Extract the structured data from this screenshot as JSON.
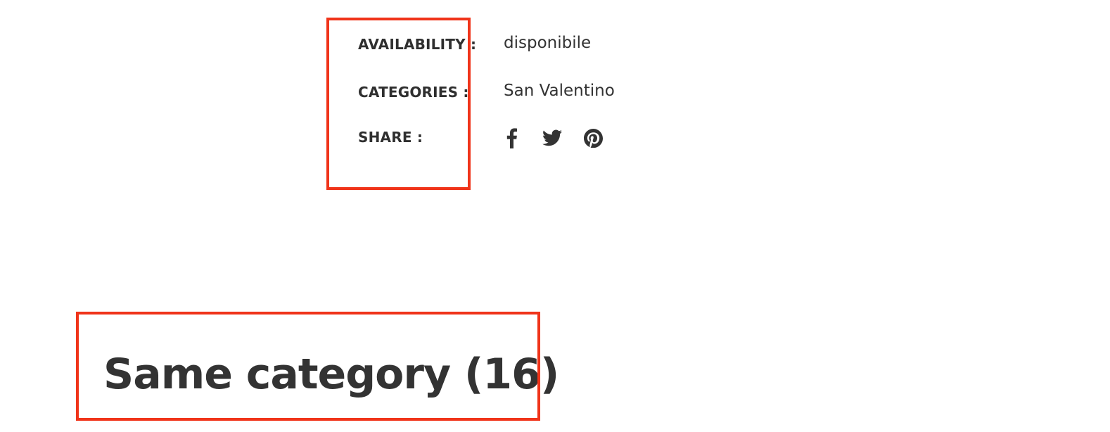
{
  "product_meta": {
    "availability": {
      "label": "AVAILABILITY :",
      "value": "disponibile"
    },
    "categories": {
      "label": "CATEGORIES :",
      "value": "San Valentino"
    },
    "share": {
      "label": "SHARE :",
      "icons": [
        "facebook-icon",
        "twitter-icon",
        "pinterest-icon"
      ]
    }
  },
  "related_section": {
    "title": "Same category (16)"
  },
  "colors": {
    "text": "#333333",
    "highlight_border": "#f0341a"
  }
}
